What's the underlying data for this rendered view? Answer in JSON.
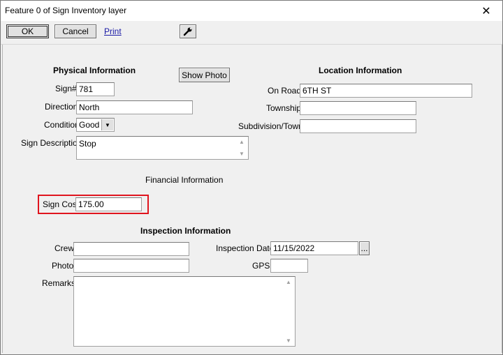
{
  "window": {
    "title": "Feature 0 of Sign Inventory layer",
    "close_glyph": "✕"
  },
  "toolbar": {
    "ok_label": "OK",
    "cancel_label": "Cancel",
    "print_label": "Print",
    "tool_icon": "wrench-icon"
  },
  "physical": {
    "heading": "Physical Information",
    "sign_num_label": "Sign#",
    "sign_num_value": "781",
    "direction_label": "Direction",
    "direction_value": "North",
    "condition_label": "Condition",
    "condition_value": "Good",
    "description_label": "Sign Description",
    "description_value": "Stop"
  },
  "show_photo_label": "Show Photo",
  "location": {
    "heading": "Location Information",
    "on_road_label": "On Road",
    "on_road_value": "6TH ST",
    "township_label": "Township",
    "township_value": "",
    "subdivision_label": "Subdivision/Town",
    "subdivision_value": ""
  },
  "financial": {
    "heading": "Financial Information",
    "sign_cost_label": "Sign Cost",
    "sign_cost_value": "175.00"
  },
  "inspection": {
    "heading": "Inspection Information",
    "crew_label": "Crew",
    "crew_value": "",
    "photo_label": "Photo",
    "photo_value": "",
    "date_label": "Inspection Date",
    "date_value": "11/15/2022",
    "date_button": "...",
    "gps_label": "GPS",
    "gps_value": "",
    "remarks_label": "Remarks",
    "remarks_value": ""
  },
  "colors": {
    "highlight": "#e0141e",
    "link": "#1a1aa6"
  }
}
